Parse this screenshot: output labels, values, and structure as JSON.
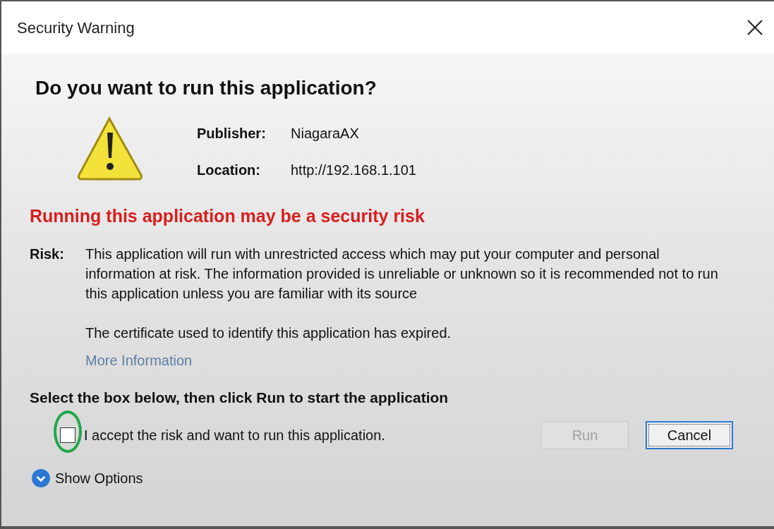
{
  "window": {
    "title": "Security Warning"
  },
  "heading": "Do you want to run this application?",
  "details": [
    {
      "label": "Publisher:",
      "value": "NiagaraAX"
    },
    {
      "label": "Location:",
      "value": "http://192.168.1.101"
    }
  ],
  "warning": "Running this application may be a security risk",
  "risk": {
    "label": "Risk:",
    "paragraphs": [
      "This application will run with unrestricted access which may put your computer and personal information at risk. The information provided is unreliable or unknown so it is recommended not to run this application unless you are familiar with its source",
      "The certificate used to identify this application has expired."
    ],
    "link": "More Information"
  },
  "instruction": "Select the box below, then click Run to start the application",
  "accept": {
    "label": "I accept the risk and want to run this application.",
    "checked": false
  },
  "buttons": [
    {
      "label": "Run",
      "disabled": true,
      "focused": false
    },
    {
      "label": "Cancel",
      "disabled": false,
      "focused": true
    }
  ],
  "show_options": {
    "label": "Show Options",
    "expanded": false
  }
}
